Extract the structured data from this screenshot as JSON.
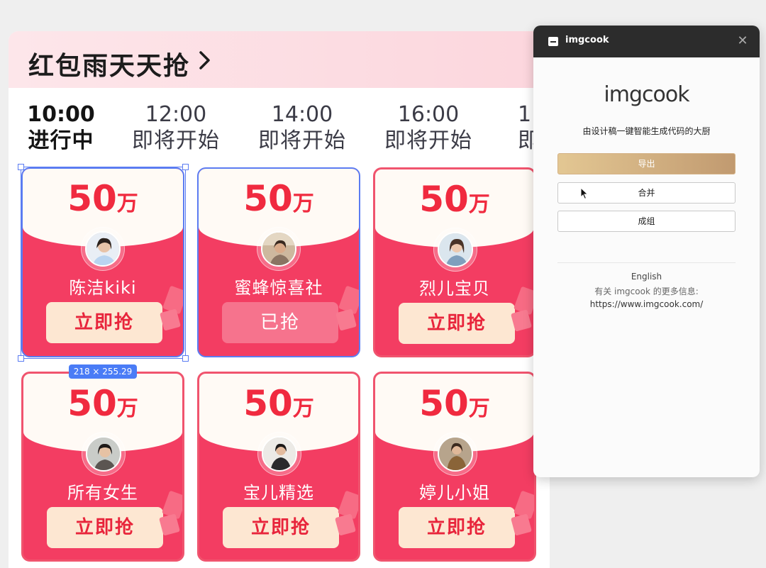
{
  "banner": {
    "title": "红包雨天天抢"
  },
  "tabs": [
    {
      "time": "10:00",
      "status": "进行中",
      "active": true
    },
    {
      "time": "12:00",
      "status": "即将开始"
    },
    {
      "time": "14:00",
      "status": "即将开始"
    },
    {
      "time": "16:00",
      "status": "即将开始"
    },
    {
      "time": "1",
      "status": "即"
    }
  ],
  "cards": [
    {
      "amount": "50",
      "unit": "万",
      "name": "陈洁kiki",
      "button": "立即抢"
    },
    {
      "amount": "50",
      "unit": "万",
      "name": "蜜蜂惊喜社",
      "button": "已抢"
    },
    {
      "amount": "50",
      "unit": "万",
      "name": "烈儿宝贝",
      "button": "立即抢"
    },
    {
      "amount": "50",
      "unit": "万",
      "name": "所有女生",
      "button": "立即抢"
    },
    {
      "amount": "50",
      "unit": "万",
      "name": "宝儿精选",
      "button": "立即抢"
    },
    {
      "amount": "50",
      "unit": "万",
      "name": "婷儿小姐",
      "button": "立即抢"
    }
  ],
  "selection": {
    "dimensions": "218 × 255.29"
  },
  "plugin": {
    "title": "imgcook",
    "logo": "imgcook",
    "subtitle": "由设计稿一键智能生成代码的大厨",
    "export_label": "导出",
    "merge_label": "合并",
    "group_label": "成组",
    "language": "English",
    "info": "有关 imgcook 的更多信息:",
    "url": "https://www.imgcook.com/"
  },
  "colors": {
    "brand_red": "#f33d62",
    "amount_red": "#f02a3f",
    "button_cream": "#fde7d2",
    "selection_blue": "#5b7cf2"
  }
}
